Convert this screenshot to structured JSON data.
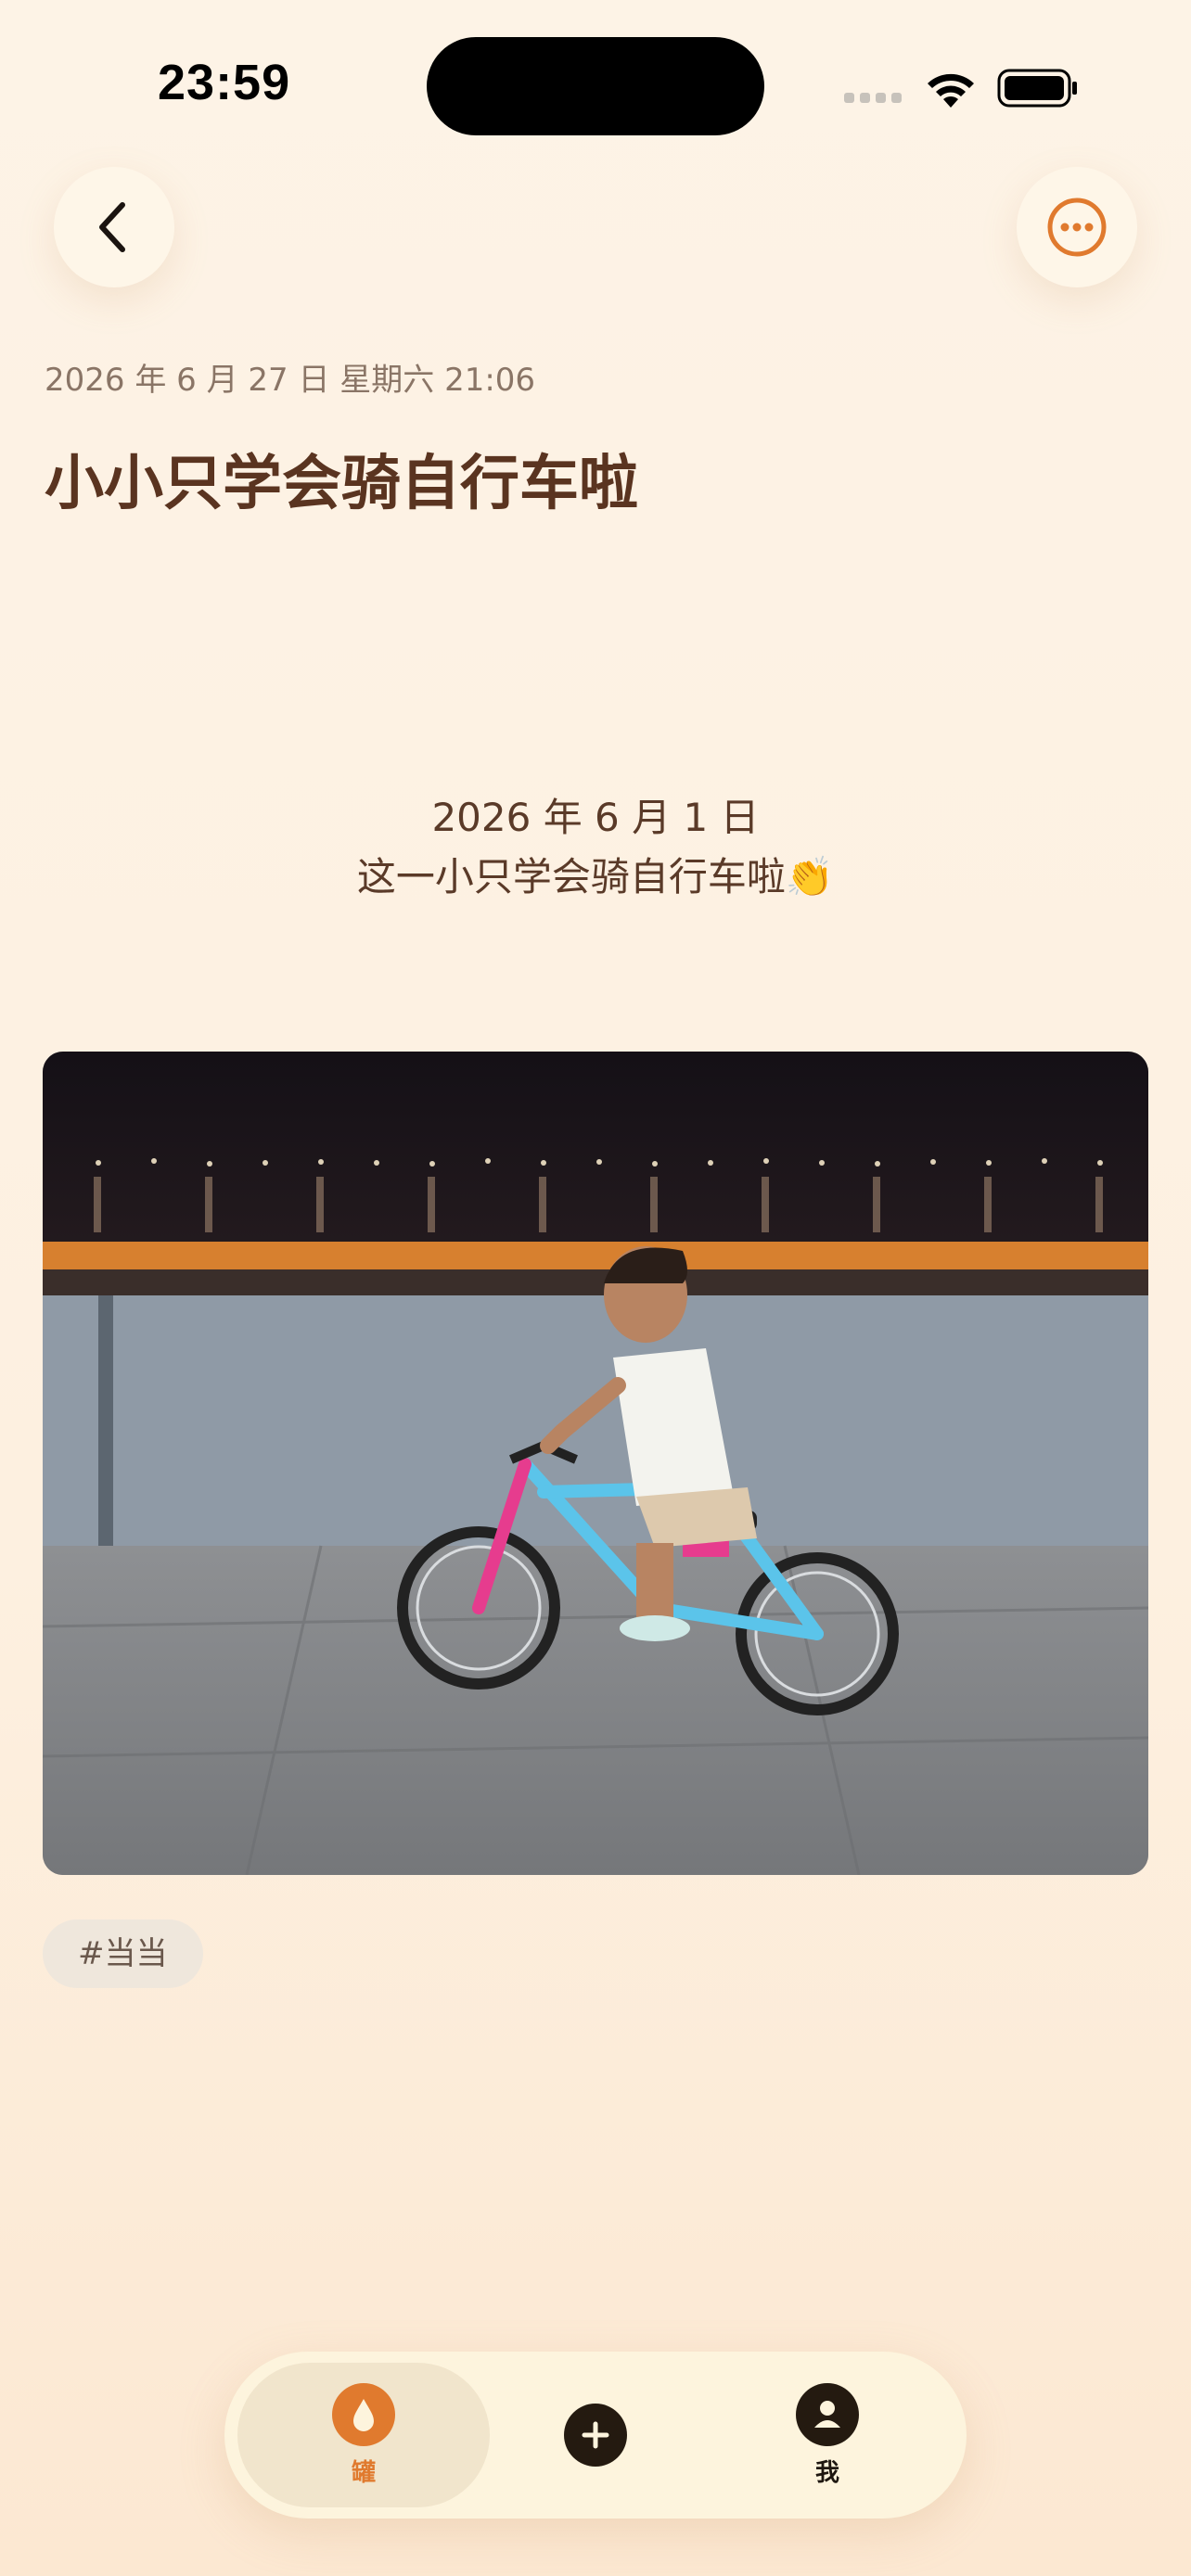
{
  "status_bar": {
    "time": "23:59"
  },
  "post": {
    "date": "2026 年 6 月 27 日 星期六 21:06",
    "title": "小小只学会骑自行车啦",
    "body_line1": "2026 年 6 月 1 日",
    "body_line2": "这一小只学会骑自行车啦👏",
    "tag": "#当当"
  },
  "nav": {
    "back_icon": "chevron-left-icon",
    "more_icon": "more-horizontal-icon"
  },
  "tabbar": {
    "items": [
      {
        "label": "罐",
        "icon": "drop-icon",
        "active": true
      },
      {
        "label": "",
        "icon": "plus-icon",
        "active": false
      },
      {
        "label": "我",
        "icon": "person-icon",
        "active": false
      }
    ]
  },
  "colors": {
    "accent": "#e07a2e",
    "title": "#5a3420",
    "background": "#fdf3e6"
  }
}
